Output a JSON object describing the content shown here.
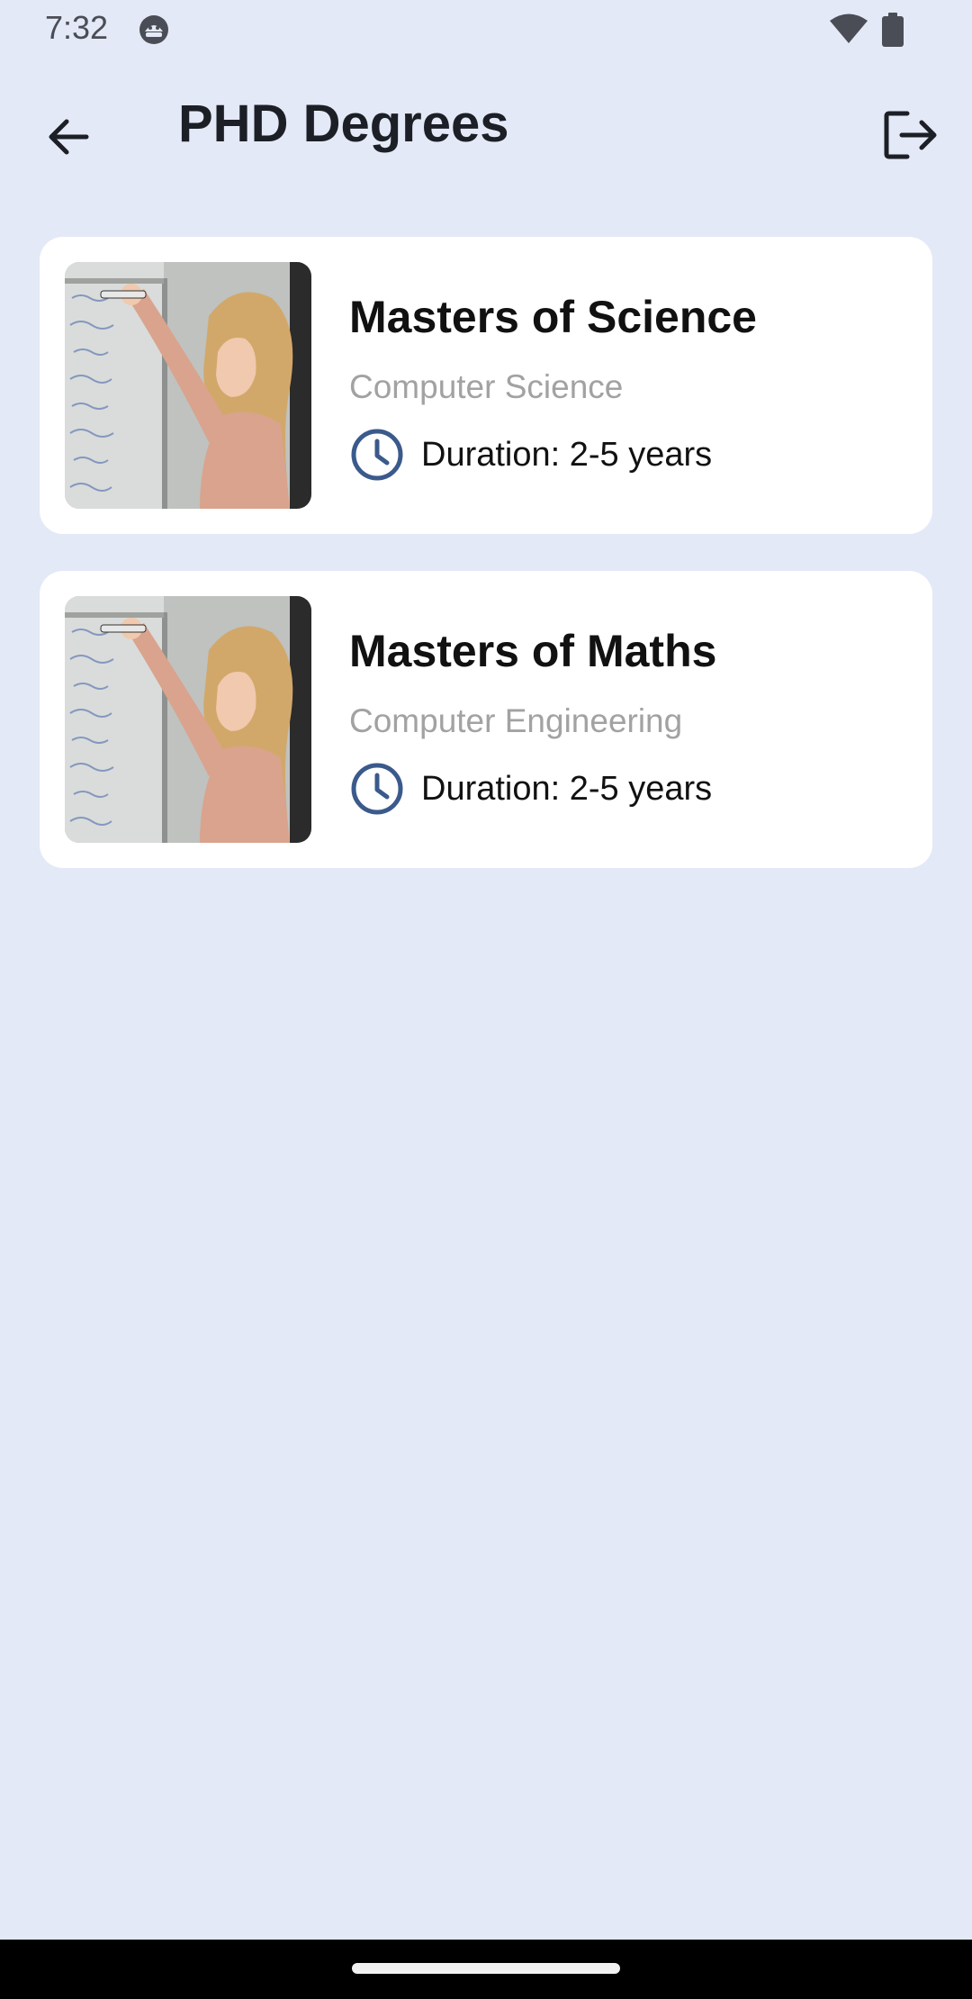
{
  "status_bar": {
    "time": "7:32",
    "app_icon": "android-debug-icon",
    "wifi_icon": "wifi-icon",
    "battery_icon": "battery-icon"
  },
  "app_bar": {
    "title": "PHD Degrees",
    "back_icon": "arrow-back-icon",
    "logout_icon": "logout-icon"
  },
  "degrees": [
    {
      "title": "Masters of Science",
      "subtitle": "Computer Science",
      "duration": "Duration: 2-5 years",
      "image": "woman-writing-equations-on-whiteboard"
    },
    {
      "title": "Masters of Maths",
      "subtitle": "Computer Engineering",
      "duration": "Duration: 2-5 years",
      "image": "woman-writing-equations-on-whiteboard"
    }
  ],
  "colors": {
    "background": "#e4e9f7",
    "card": "#ffffff",
    "title_text": "#1c1f26",
    "subtitle_text": "#a2a2a2",
    "clock_icon": "#3b5a8c",
    "nav_bar": "#000000"
  }
}
